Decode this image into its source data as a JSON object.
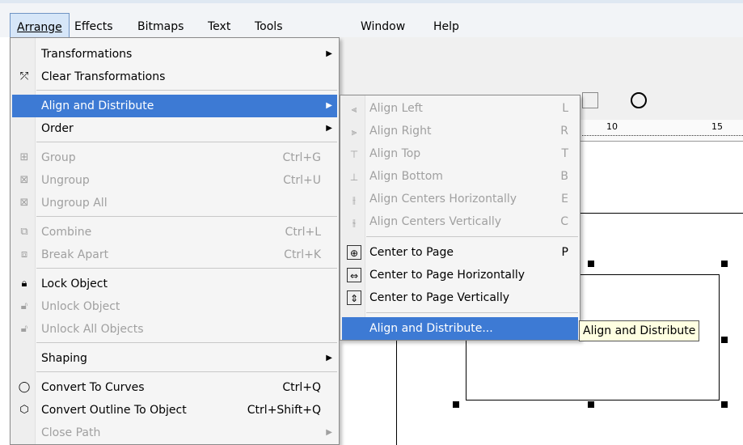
{
  "menubar": {
    "items": [
      {
        "label": "Arrange"
      },
      {
        "label": "Effects"
      },
      {
        "label": "Bitmaps"
      },
      {
        "label": "Text"
      },
      {
        "label": "Tools"
      },
      {
        "label": "Window"
      },
      {
        "label": "Help"
      }
    ]
  },
  "arrange_menu": {
    "items": [
      {
        "label": "Transformations",
        "shortcut": "",
        "icon": "transformations-icon"
      },
      {
        "label": "Clear Transformations",
        "shortcut": "",
        "icon": "clear-transformations-icon"
      },
      {
        "label": "Align and Distribute",
        "shortcut": "",
        "icon": ""
      },
      {
        "label": "Order",
        "shortcut": "",
        "icon": ""
      },
      {
        "label": "Group",
        "shortcut": "Ctrl+G",
        "icon": "group-icon"
      },
      {
        "label": "Ungroup",
        "shortcut": "Ctrl+U",
        "icon": "ungroup-icon"
      },
      {
        "label": "Ungroup All",
        "shortcut": "",
        "icon": "ungroup-all-icon"
      },
      {
        "label": "Combine",
        "shortcut": "Ctrl+L",
        "icon": "combine-icon"
      },
      {
        "label": "Break Apart",
        "shortcut": "Ctrl+K",
        "icon": "break-apart-icon"
      },
      {
        "label": "Lock Object",
        "shortcut": "",
        "icon": "lock-icon"
      },
      {
        "label": "Unlock Object",
        "shortcut": "",
        "icon": "unlock-icon"
      },
      {
        "label": "Unlock All Objects",
        "shortcut": "",
        "icon": "unlock-all-icon"
      },
      {
        "label": "Shaping",
        "shortcut": "",
        "icon": ""
      },
      {
        "label": "Convert To Curves",
        "shortcut": "Ctrl+Q",
        "icon": "convert-curves-icon"
      },
      {
        "label": "Convert Outline To Object",
        "shortcut": "Ctrl+Shift+Q",
        "icon": "convert-outline-icon"
      },
      {
        "label": "Close Path",
        "shortcut": "",
        "icon": ""
      }
    ]
  },
  "align_submenu": {
    "items": [
      {
        "label": "Align Left",
        "shortcut": "L"
      },
      {
        "label": "Align Right",
        "shortcut": "R"
      },
      {
        "label": "Align Top",
        "shortcut": "T"
      },
      {
        "label": "Align Bottom",
        "shortcut": "B"
      },
      {
        "label": "Align Centers Horizontally",
        "shortcut": "E"
      },
      {
        "label": "Align Centers Vertically",
        "shortcut": "C"
      },
      {
        "label": "Center to Page",
        "shortcut": "P"
      },
      {
        "label": "Center to Page Horizontally",
        "shortcut": ""
      },
      {
        "label": "Center to Page Vertically",
        "shortcut": ""
      },
      {
        "label": "Align and Distribute...",
        "shortcut": ""
      }
    ]
  },
  "tooltip": {
    "text": "Align and Distribute"
  },
  "ruler": {
    "tick_10": "10",
    "tick_15": "15"
  }
}
